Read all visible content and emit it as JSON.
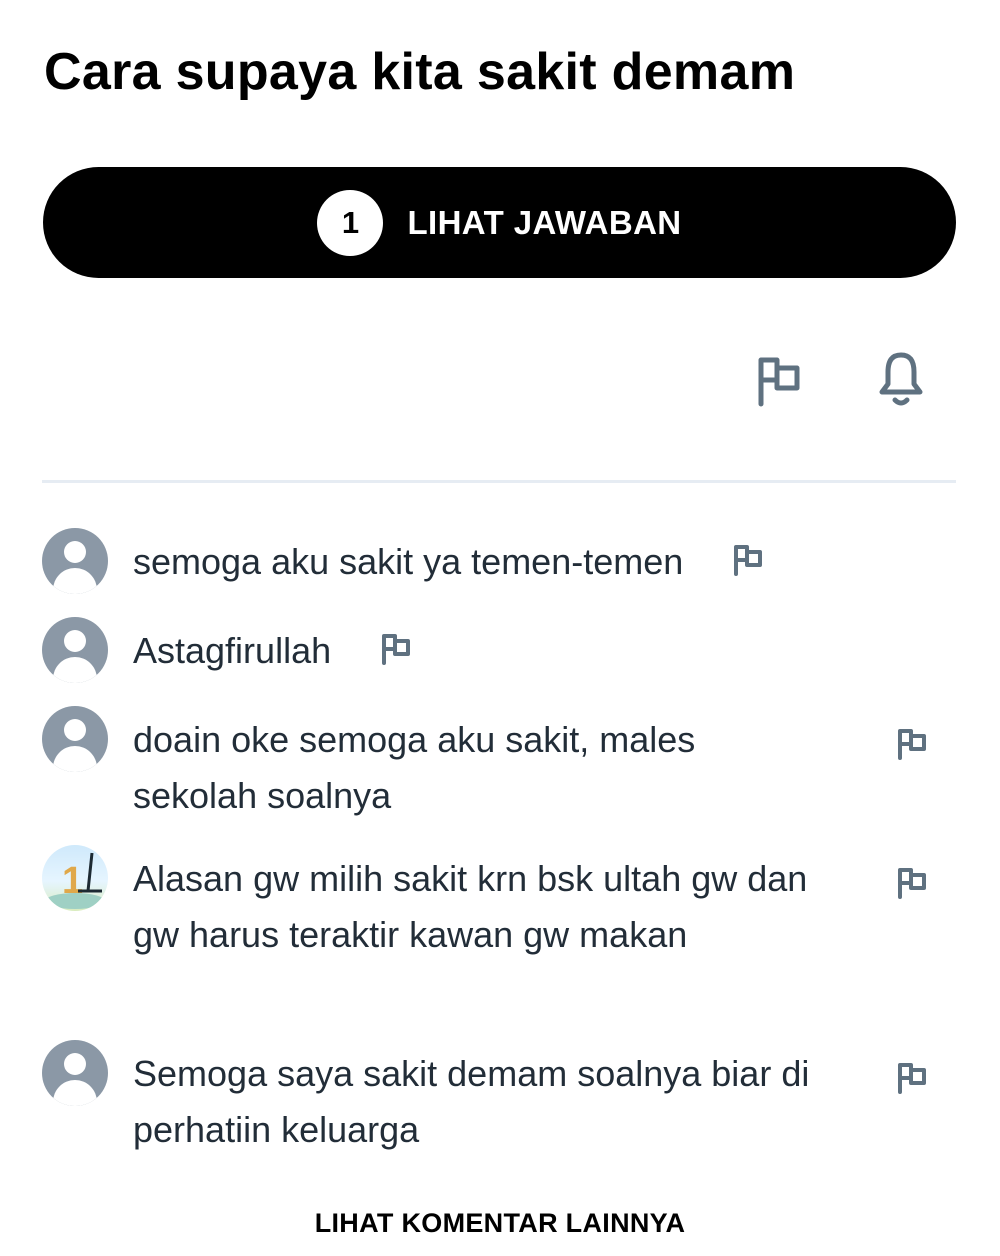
{
  "question": {
    "title": "Cara supaya kita sakit demam"
  },
  "answer_button": {
    "count": "1",
    "label": "LIHAT JAWABAN"
  },
  "actions": {
    "icons": [
      "flag-icon",
      "bell-icon"
    ]
  },
  "comments": [
    {
      "avatar": "default-avatar",
      "text": "semoga aku sakit ya temen-temen"
    },
    {
      "avatar": "default-avatar",
      "text": "Astagfirullah"
    },
    {
      "avatar": "default-avatar",
      "text": "doain oke semoga aku sakit, males sekolah soalnya"
    },
    {
      "avatar": "custom-avatar",
      "text": "Alasan gw milih sakit krn bsk ultah gw dan gw harus teraktir kawan gw makan"
    },
    {
      "avatar": "default-avatar",
      "text": "Semoga saya sakit demam soalnya biar di perhatiin keluarga"
    }
  ],
  "more_comments": {
    "label": "LIHAT KOMENTAR LAINNYA"
  },
  "colors": {
    "primary": "#000000",
    "text": "#222d38",
    "icon": "#5f7180",
    "avatar": "#8b98a6",
    "divider": "#e6ecf3"
  }
}
